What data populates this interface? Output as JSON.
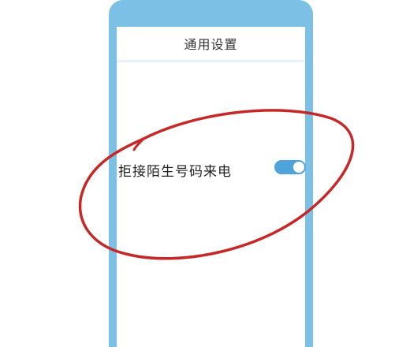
{
  "header": {
    "title": "通用设置"
  },
  "setting": {
    "label": "拒接陌生号码来电",
    "enabled": true
  },
  "colors": {
    "frame": "#7cc0e6",
    "toggle_on": "#4fa3db",
    "annotation": "#c62828"
  }
}
